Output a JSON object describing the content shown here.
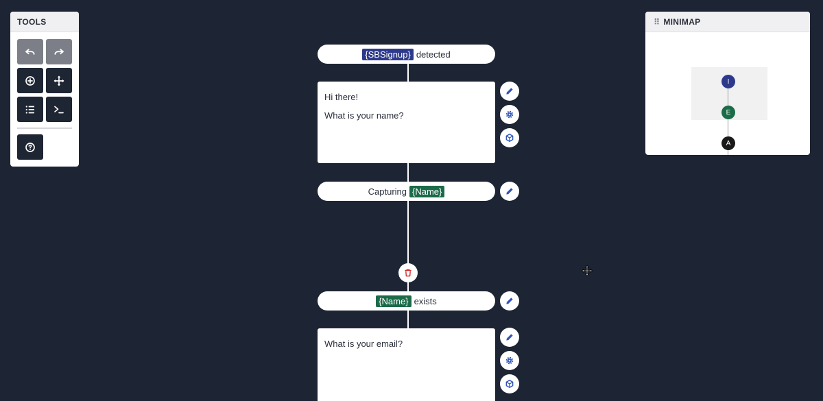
{
  "tools": {
    "title": "TOOLS",
    "buttons": [
      {
        "name": "undo",
        "icon": "undo-icon"
      },
      {
        "name": "redo",
        "icon": "redo-icon"
      },
      {
        "name": "add",
        "icon": "plus-circle-icon"
      },
      {
        "name": "move",
        "icon": "move-arrows-icon"
      },
      {
        "name": "list",
        "icon": "list-icon"
      },
      {
        "name": "console",
        "icon": "terminal-icon"
      },
      {
        "name": "help",
        "icon": "question-circle-icon"
      }
    ]
  },
  "minimap": {
    "title": "MINIMAP",
    "nodes": [
      {
        "label": "I",
        "color": "#2d3a8c"
      },
      {
        "label": "E",
        "color": "#1b6b49"
      },
      {
        "label": "A",
        "color": "#1a1a1a"
      }
    ]
  },
  "flow": {
    "trigger": {
      "tag": "{SBSignup}",
      "text": "detected"
    },
    "message1": {
      "lines": [
        "Hi there!",
        "What is your name?"
      ]
    },
    "capture": {
      "text": "Capturing",
      "tag": "{Name}"
    },
    "condition": {
      "tag": "{Name}",
      "text": "exists"
    },
    "message2": {
      "lines": [
        "What is your email?"
      ]
    }
  },
  "colors": {
    "background": "#1d2433",
    "variable_blue": "#2d3a8c",
    "variable_green": "#1b6b49",
    "action_blue": "#2f55b8",
    "delete_red": "#d22a2a"
  }
}
